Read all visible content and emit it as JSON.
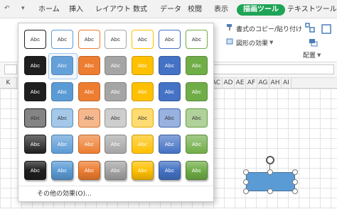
{
  "quick_access": {
    "undo_arrow": "↶",
    "dropdown_arrow": "▾"
  },
  "tabs": [
    {
      "label": "ホーム",
      "active": false
    },
    {
      "label": "挿入",
      "active": false
    },
    {
      "label": "レイアウト",
      "active": false
    },
    {
      "label": "数式",
      "active": false
    },
    {
      "label": "データ",
      "active": false
    },
    {
      "label": "校閲",
      "active": false
    },
    {
      "label": "表示",
      "active": false
    },
    {
      "label": "描画ツール",
      "active": true
    },
    {
      "label": "テキストツール",
      "active": false
    }
  ],
  "ribbon": {
    "format_copy_label": "書式のコピー/貼り付け",
    "shape_effects_label": "図形の効果",
    "arrange_label": "配置"
  },
  "column_headers": [
    "K",
    "AC",
    "AD",
    "AE",
    "AF",
    "AG",
    "AH",
    "AI"
  ],
  "gallery": {
    "swatch_text": "Abc",
    "more_effects_label": "その他の効果(O)...",
    "colors": {
      "black": "#1f1f1f",
      "blue_light": "#5b9bd5",
      "orange": "#ed7d31",
      "gray": "#a5a5a5",
      "gold": "#ffc000",
      "blue_dark": "#4472c4",
      "green": "#70ad47"
    },
    "rows": [
      {
        "style": "outline"
      },
      {
        "style": "solid"
      },
      {
        "style": "solid"
      },
      {
        "style": "light"
      },
      {
        "style": "gradient"
      },
      {
        "style": "glossy"
      }
    ]
  },
  "shape": {
    "fill_color": "#5b9bd5"
  }
}
